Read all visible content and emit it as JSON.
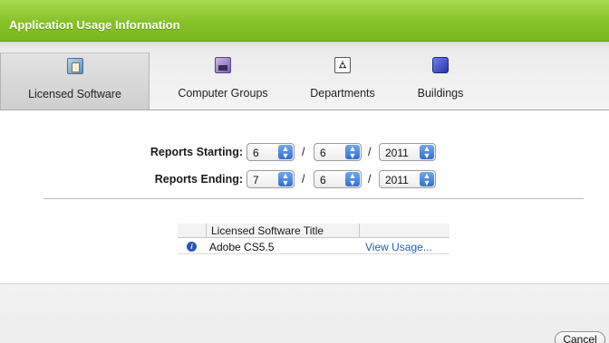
{
  "window": {
    "title": "Application Usage Information"
  },
  "tabs": [
    {
      "label": "Licensed Software",
      "icon": "licensed-software-icon",
      "selected": true
    },
    {
      "label": "Computer Groups",
      "icon": "computer-groups-icon",
      "selected": false
    },
    {
      "label": "Departments",
      "icon": "departments-icon",
      "selected": false
    },
    {
      "label": "Buildings",
      "icon": "buildings-icon",
      "selected": false
    }
  ],
  "reports": {
    "starting_label": "Reports Starting:",
    "starting": {
      "month": "6",
      "day": "6",
      "year": "2011"
    },
    "ending_label": "Reports Ending:",
    "ending": {
      "month": "7",
      "day": "6",
      "year": "2011"
    },
    "separator": "/"
  },
  "table": {
    "headers": [
      "",
      "Licensed Software Title",
      ""
    ],
    "rows": [
      {
        "info_icon": "info-icon",
        "title": "Adobe CS5.5",
        "action": "View Usage..."
      }
    ]
  },
  "footer": {
    "cancel_label": "Cancel"
  },
  "colors": {
    "title_bar": "#86c228",
    "link": "#1f5fbf",
    "select_arrow": "#2f6fd6"
  }
}
